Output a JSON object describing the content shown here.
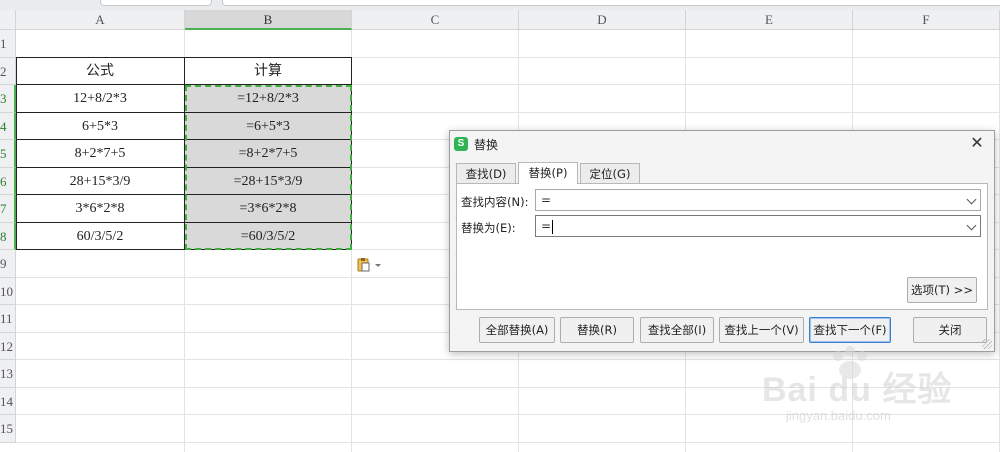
{
  "sheet": {
    "columns": [
      "A",
      "B",
      "C",
      "D",
      "E",
      "F"
    ],
    "rows": [
      "1",
      "2",
      "3",
      "4",
      "5",
      "6",
      "7",
      "8",
      "9",
      "10",
      "11",
      "12",
      "13",
      "14",
      "15"
    ],
    "table": {
      "headers": [
        "公式",
        "计算"
      ],
      "rows": [
        [
          "12+8/2*3",
          "=12+8/2*3"
        ],
        [
          "6+5*3",
          "=6+5*3"
        ],
        [
          "8+2*7+5",
          "=8+2*7+5"
        ],
        [
          "28+15*3/9",
          "=28+15*3/9"
        ],
        [
          "3*6*2*8",
          "=3*6*2*8"
        ],
        [
          "60/3/5/2",
          "=60/3/5/2"
        ]
      ]
    },
    "selected_column": "B",
    "selection_accent": "#3fae3f"
  },
  "dialog": {
    "title": "替换",
    "logo_glyph": "S",
    "close_glyph": "✕",
    "tabs": [
      {
        "label": "查找(D)",
        "active": false
      },
      {
        "label": "替换(P)",
        "active": true
      },
      {
        "label": "定位(G)",
        "active": false
      }
    ],
    "find_label": "查找内容(N):",
    "find_value": "=",
    "replace_label": "替换为(E):",
    "replace_value": "=",
    "options_button": "选项(T) >>",
    "buttons": {
      "replace_all": "全部替换(A)",
      "replace": "替换(R)",
      "find_all": "查找全部(I)",
      "find_prev": "查找上一个(V)",
      "find_next": "查找下一个(F)",
      "close": "关闭"
    }
  },
  "watermark": {
    "brand": "Bai du 经验",
    "url": "jingyan.baidu.com"
  }
}
